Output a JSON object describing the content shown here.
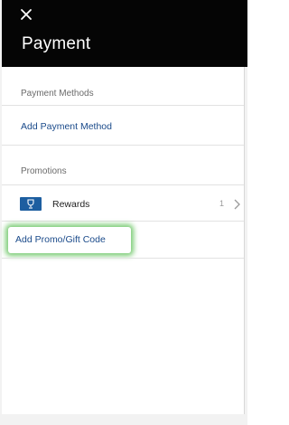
{
  "header": {
    "title": "Payment",
    "close_icon": "close-icon"
  },
  "payment_methods": {
    "section_label": "Payment Methods",
    "add_label": "Add Payment Method"
  },
  "promotions": {
    "section_label": "Promotions",
    "rewards": {
      "icon": "rewards-icon",
      "label": "Rewards",
      "count": "1"
    },
    "promo_label": "Add Promo/Gift Code"
  },
  "colors": {
    "header_bg": "#050505",
    "link": "#1a4a8a",
    "rewards_icon": "#1d5ea0",
    "highlight": "#4cb944"
  }
}
